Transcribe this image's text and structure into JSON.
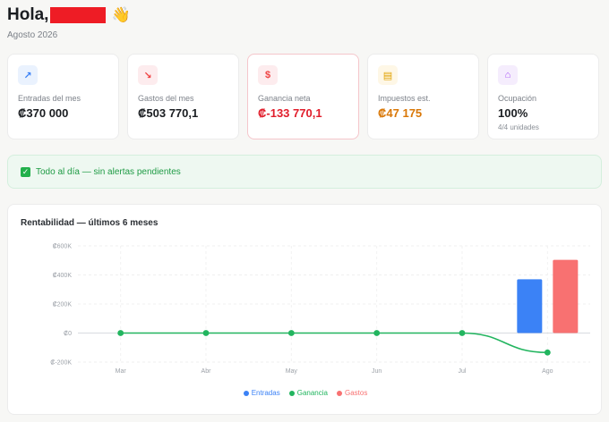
{
  "header": {
    "greeting": "Hola,",
    "wave": "👋",
    "period": "Agosto 2026"
  },
  "cards": [
    {
      "label": "Entradas del mes",
      "value": "₡370 000",
      "icon": "trend-up-icon",
      "icon_glyph": "↗",
      "icon_bg": "#eaf2fe",
      "icon_color": "#3b82f6",
      "value_color": "#1a1d21"
    },
    {
      "label": "Gastos del mes",
      "value": "₡503 770,1",
      "icon": "trend-down-icon",
      "icon_glyph": "↘",
      "icon_bg": "#fdecee",
      "icon_color": "#ef4444",
      "value_color": "#1a1d21"
    },
    {
      "label": "Ganancia neta",
      "value": "₡-133 770,1",
      "icon": "dollar-icon",
      "icon_glyph": "$",
      "icon_bg": "#fdecee",
      "icon_color": "#ef4444",
      "value_color": "#e11d2b"
    },
    {
      "label": "Impuestos est.",
      "value": "₡47 175",
      "icon": "receipt-icon",
      "icon_glyph": "▤",
      "icon_bg": "#fef7e6",
      "icon_color": "#e0a100",
      "value_color": "#d97706"
    },
    {
      "label": "Ocupación",
      "value": "100%",
      "sub": "4/4 unidades",
      "icon": "home-icon",
      "icon_glyph": "⌂",
      "icon_bg": "#f5edfd",
      "icon_color": "#a855f7",
      "value_color": "#1a1d21"
    }
  ],
  "alert": {
    "text": "Todo al día — sin alertas pendientes"
  },
  "chart_title": "Rentabilidad — últimos 6 meses",
  "chart_data": {
    "type": "bar",
    "categories": [
      "Mar",
      "Abr",
      "May",
      "Jun",
      "Jul",
      "Ago"
    ],
    "yticks": [
      "₡600K",
      "₡400K",
      "₡200K",
      "₡0",
      "₡-200K"
    ],
    "ylim": [
      -200000,
      600000
    ],
    "grid": true,
    "legend": "bottom-center",
    "series": [
      {
        "name": "Entradas",
        "kind": "bar",
        "color": "#3b82f6",
        "values": [
          0,
          0,
          0,
          0,
          0,
          370000
        ]
      },
      {
        "name": "Ganancia",
        "kind": "line",
        "color": "#22b55f",
        "values": [
          0,
          0,
          0,
          0,
          0,
          -133770.1
        ]
      },
      {
        "name": "Gastos",
        "kind": "bar",
        "color": "#f87171",
        "values": [
          0,
          0,
          0,
          0,
          0,
          503770.1
        ]
      }
    ]
  }
}
